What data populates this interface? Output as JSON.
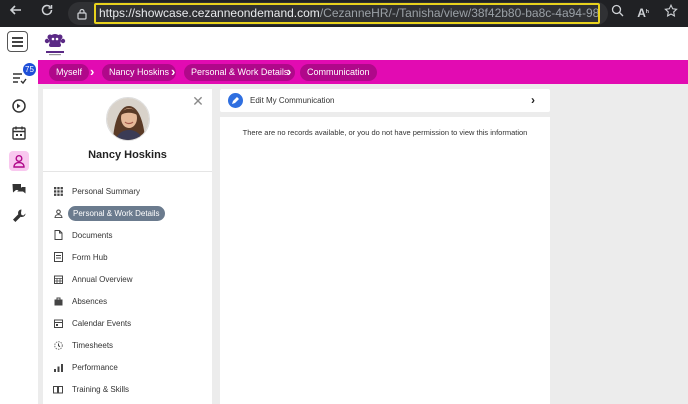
{
  "browser": {
    "url_host": "https://showcase.cezanneondemand.com",
    "url_path": "/CezanneHR/-/Tanisha/view/38f42b80-ba8c-4a94-9868-d5f641c1d66f?ce..."
  },
  "rail": {
    "badge_count": "75"
  },
  "breadcrumbs": [
    "Myself",
    "Nancy Hoskins",
    "Personal & Work Details",
    "Communication"
  ],
  "profile": {
    "name": "Nancy Hoskins",
    "menu": [
      {
        "label": "Personal Summary",
        "icon": "grid-icon"
      },
      {
        "label": "Personal & Work Details",
        "icon": "user-icon",
        "selected": true
      },
      {
        "label": "Documents",
        "icon": "document-icon"
      },
      {
        "label": "Form Hub",
        "icon": "form-icon"
      },
      {
        "label": "Annual Overview",
        "icon": "calendar-grid-icon"
      },
      {
        "label": "Absences",
        "icon": "suitcase-icon"
      },
      {
        "label": "Calendar Events",
        "icon": "calendar-icon"
      },
      {
        "label": "Timesheets",
        "icon": "clock-icon"
      },
      {
        "label": "Performance",
        "icon": "bar-chart-icon"
      },
      {
        "label": "Training & Skills",
        "icon": "book-icon"
      }
    ]
  },
  "main": {
    "edit_label": "Edit My Communication",
    "empty_message": "There are no records available, or you do not have permission to view this information"
  },
  "colors": {
    "accent": "#e20bb2",
    "crumb_bg": "#b0088a",
    "selected_item": "#6b7b8e",
    "badge": "#1e4fd8"
  }
}
